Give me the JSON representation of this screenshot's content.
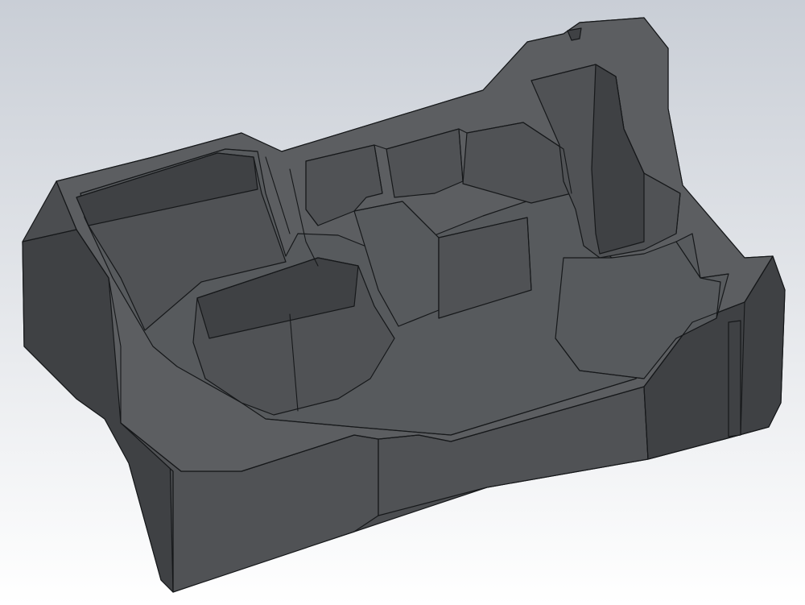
{
  "scene": {
    "background_top": "#c9ced6",
    "background_bottom": "#ffffff",
    "body_color": "#4b4d50",
    "face_light": "#5c5e61",
    "face_mid": "#505255",
    "face_dark": "#3f4144",
    "pocket_floor": "#575a5d",
    "edge_color": "#16181a"
  }
}
